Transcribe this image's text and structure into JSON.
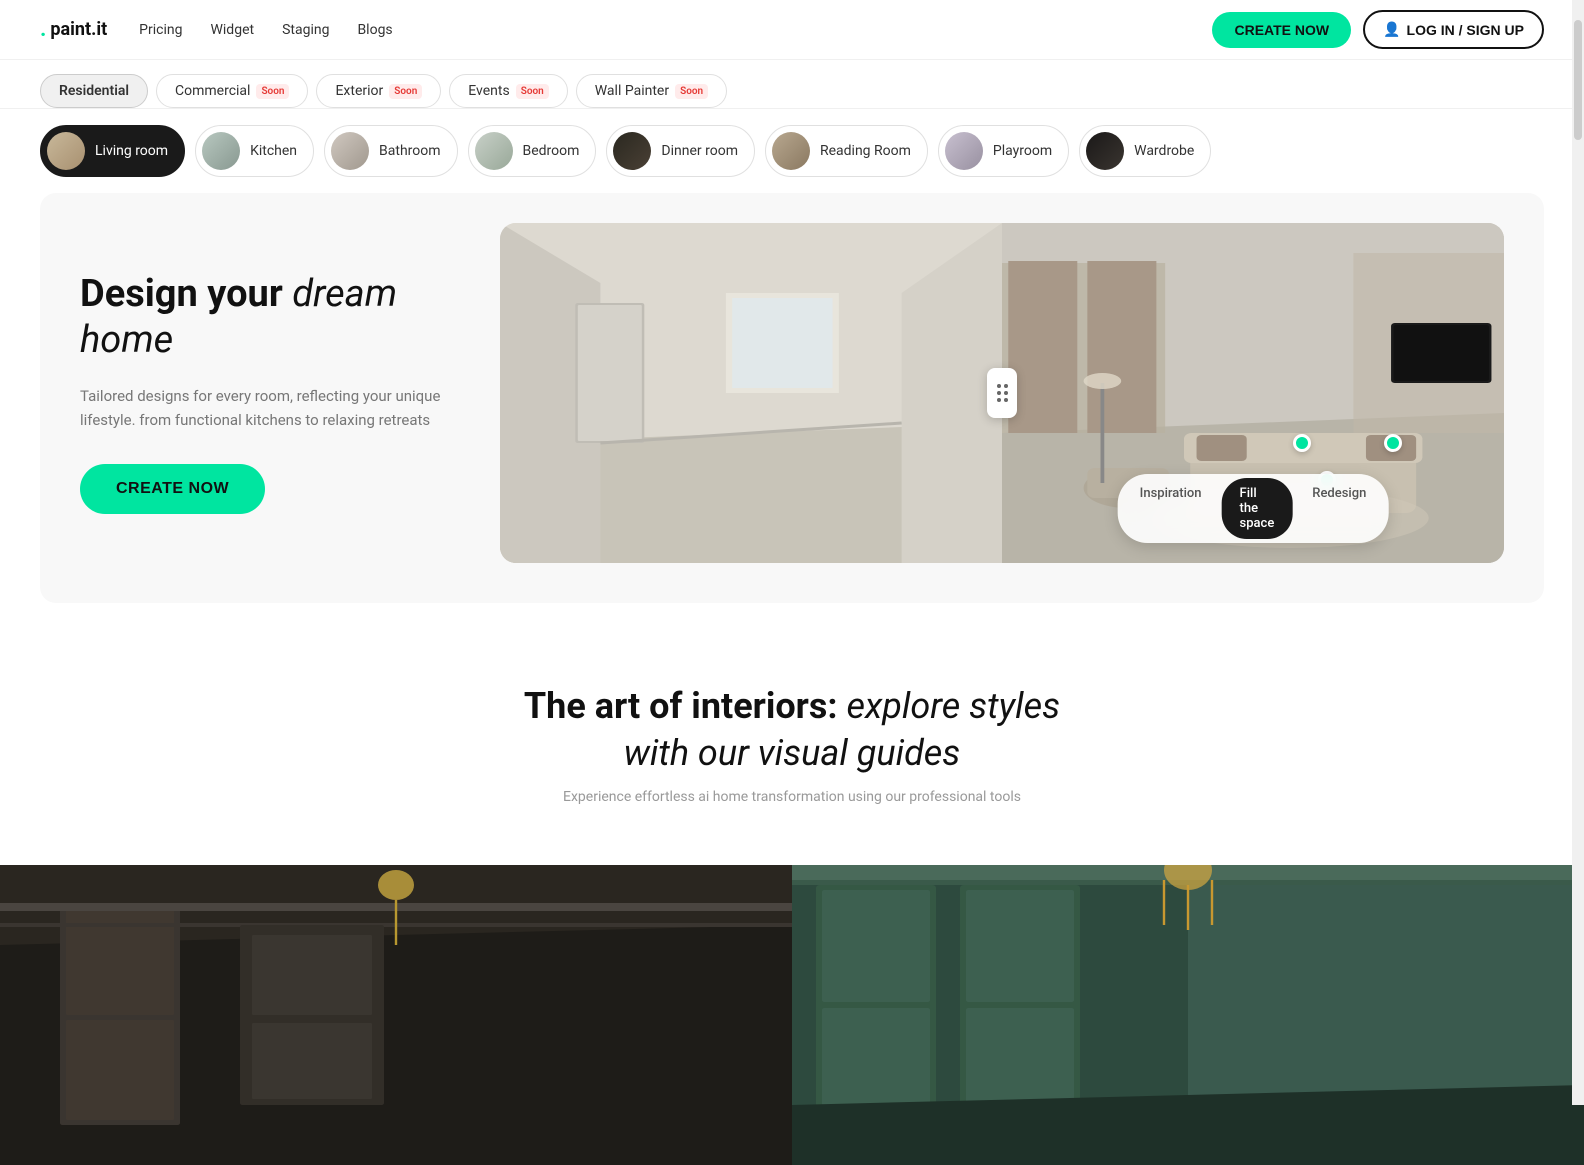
{
  "brand": {
    "name": "paint.it",
    "dot": "."
  },
  "nav": {
    "links": [
      "Pricing",
      "Widget",
      "Staging",
      "Blogs"
    ],
    "cta": "CREATE NOW",
    "login": "LOG IN / SIGN UP"
  },
  "tabs": [
    {
      "label": "Residential",
      "active": true,
      "soon": false
    },
    {
      "label": "Commercial",
      "active": false,
      "soon": true
    },
    {
      "label": "Exterior",
      "active": false,
      "soon": true
    },
    {
      "label": "Events",
      "active": false,
      "soon": true
    },
    {
      "label": "Wall Painter",
      "active": false,
      "soon": true
    }
  ],
  "rooms": [
    {
      "label": "Living room",
      "active": true,
      "thumbClass": "thumb-living"
    },
    {
      "label": "Kitchen",
      "active": false,
      "thumbClass": "thumb-kitchen"
    },
    {
      "label": "Bathroom",
      "active": false,
      "thumbClass": "thumb-bathroom"
    },
    {
      "label": "Bedroom",
      "active": false,
      "thumbClass": "thumb-bedroom"
    },
    {
      "label": "Dinner room",
      "active": false,
      "thumbClass": "thumb-dinner"
    },
    {
      "label": "Reading Room",
      "active": false,
      "thumbClass": "thumb-reading"
    },
    {
      "label": "Playroom",
      "active": false,
      "thumbClass": "thumb-playroom"
    },
    {
      "label": "Wardrobe",
      "active": false,
      "thumbClass": "thumb-wardrobe"
    }
  ],
  "hero": {
    "title_normal": "Design your ",
    "title_italic": "dream home",
    "description": "Tailored designs for every room, reflecting your unique lifestyle. from functional kitchens to relaxing retreats",
    "cta": "CREATE NOW"
  },
  "modes": [
    {
      "label": "Inspiration",
      "active": false
    },
    {
      "label": "Fill the space",
      "active": true
    },
    {
      "label": "Redesign",
      "active": false
    }
  ],
  "art_section": {
    "title_normal": "The art of interiors: ",
    "title_italic": "explore styles\nwith our visual guides",
    "subtitle": "Experience effortless ai home transformation using our professional tools"
  }
}
